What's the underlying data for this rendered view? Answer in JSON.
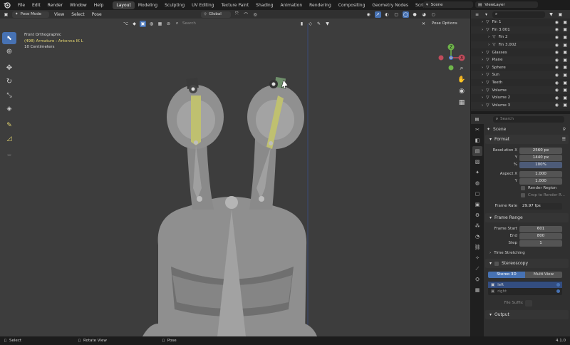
{
  "topbar": {
    "menu": [
      "File",
      "Edit",
      "Render",
      "Window",
      "Help"
    ],
    "workspaces": [
      "Layout",
      "Modeling",
      "Sculpting",
      "UV Editing",
      "Texture Paint",
      "Shading",
      "Animation",
      "Rendering",
      "Compositing",
      "Geometry Nodes",
      "Scripting"
    ],
    "active_workspace": "Layout",
    "add_tab": "+",
    "scene_name": "Scene",
    "view_layer": "ViewLayer"
  },
  "viewport": {
    "mode": "Pose Mode",
    "menus": [
      "View",
      "Select",
      "Pose"
    ],
    "orientation": "Global",
    "pose_options": "Pose Options",
    "search_placeholder": "Search",
    "overlay": {
      "view_name": "Front Orthographic",
      "object_info": "(498) Armature : Antenna IK L",
      "scale": "10 Centimeters"
    },
    "gizmo": {
      "x": "X",
      "y": "Y",
      "z": "Z"
    }
  },
  "status": {
    "select": "Select",
    "rotate": "Rotate View",
    "pose": "Pose",
    "version": "4.1.0"
  },
  "outliner": {
    "search_placeholder": "",
    "rows": [
      {
        "name": "Fin 1",
        "indent": 1
      },
      {
        "name": "Fin 3.001",
        "indent": 1
      },
      {
        "name": "Fin 2",
        "indent": 2
      },
      {
        "name": "Fin 3.002",
        "indent": 2
      },
      {
        "name": "Glasses",
        "indent": 1
      },
      {
        "name": "Plane",
        "indent": 1
      },
      {
        "name": "Sphere",
        "indent": 1
      },
      {
        "name": "Sun",
        "indent": 1
      },
      {
        "name": "Teeth",
        "indent": 1
      },
      {
        "name": "Volume",
        "indent": 1
      },
      {
        "name": "Volume 2",
        "indent": 1
      },
      {
        "name": "Volume 3",
        "indent": 1
      }
    ]
  },
  "properties": {
    "search_placeholder": "Search",
    "context": "Scene",
    "format": {
      "title": "Format",
      "resolution_x_label": "Resolution X",
      "resolution_x": "2560 px",
      "resolution_y_label": "Y",
      "resolution_y": "1440 px",
      "percent_label": "%",
      "percent": "100%",
      "aspect_x_label": "Aspect X",
      "aspect_x": "1.000",
      "aspect_y_label": "Y",
      "aspect_y": "1.000",
      "render_region": "Render Region",
      "crop": "Crop to Render R...",
      "frame_rate_label": "Frame Rate",
      "frame_rate": "29.97 fps"
    },
    "frame_range": {
      "title": "Frame Range",
      "start_label": "Frame Start",
      "start": "601",
      "end_label": "End",
      "end": "800",
      "step_label": "Step",
      "step": "1"
    },
    "time_stretching": "Time Stretching",
    "stereoscopy": {
      "title": "Stereoscopy",
      "tab_stereo": "Stereo 3D",
      "tab_multi": "Multi-View",
      "views": [
        "left",
        "right"
      ],
      "file_suffix": "File Suffix"
    },
    "output": "Output"
  },
  "colors": {
    "accent": "#4772b3",
    "viewport_bg": "#3d3d3d",
    "armature_highlight": "#e6d770"
  }
}
